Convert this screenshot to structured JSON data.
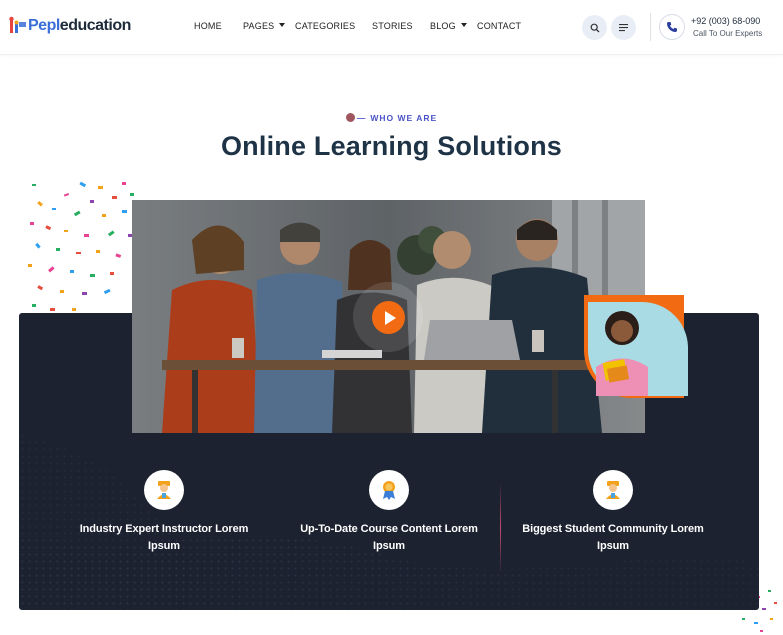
{
  "brand": {
    "logo_part_1": "Pepl",
    "logo_part_2": "education"
  },
  "nav": {
    "items": [
      {
        "label": "HOME",
        "has_dropdown": false
      },
      {
        "label": "PAGES",
        "has_dropdown": true
      },
      {
        "label": "CATEGORIES",
        "has_dropdown": false
      },
      {
        "label": "STORIES",
        "has_dropdown": false
      },
      {
        "label": "BLOG",
        "has_dropdown": true
      },
      {
        "label": "CONTACT",
        "has_dropdown": false
      }
    ]
  },
  "header_actions": {
    "search_icon": "search-icon",
    "menu_icon": "menu-icon",
    "phone_icon": "phone-icon",
    "phone_number": "+92 (003) 68-090",
    "phone_caption": "Call To Our Experts"
  },
  "section": {
    "eyebrow": "WHO WE ARE",
    "title": "Online Learning Solutions"
  },
  "video": {
    "play_icon": "play-icon"
  },
  "features": [
    {
      "icon": "instructor-icon",
      "line1": "Industry Expert Instructor Lorem",
      "line2": "Ipsum"
    },
    {
      "icon": "award-icon",
      "line1": "Up-To-Date Course Content Lorem",
      "line2": "Ipsum"
    },
    {
      "icon": "community-icon",
      "line1": "Biggest Student Community Lorem",
      "line2": "Ipsum"
    }
  ],
  "colors": {
    "accent_orange": "#f26b12",
    "heading": "#1f3347",
    "eyebrow": "#4a53c8",
    "panel": "#1c2230",
    "logo_blue": "#3b6fd8"
  }
}
